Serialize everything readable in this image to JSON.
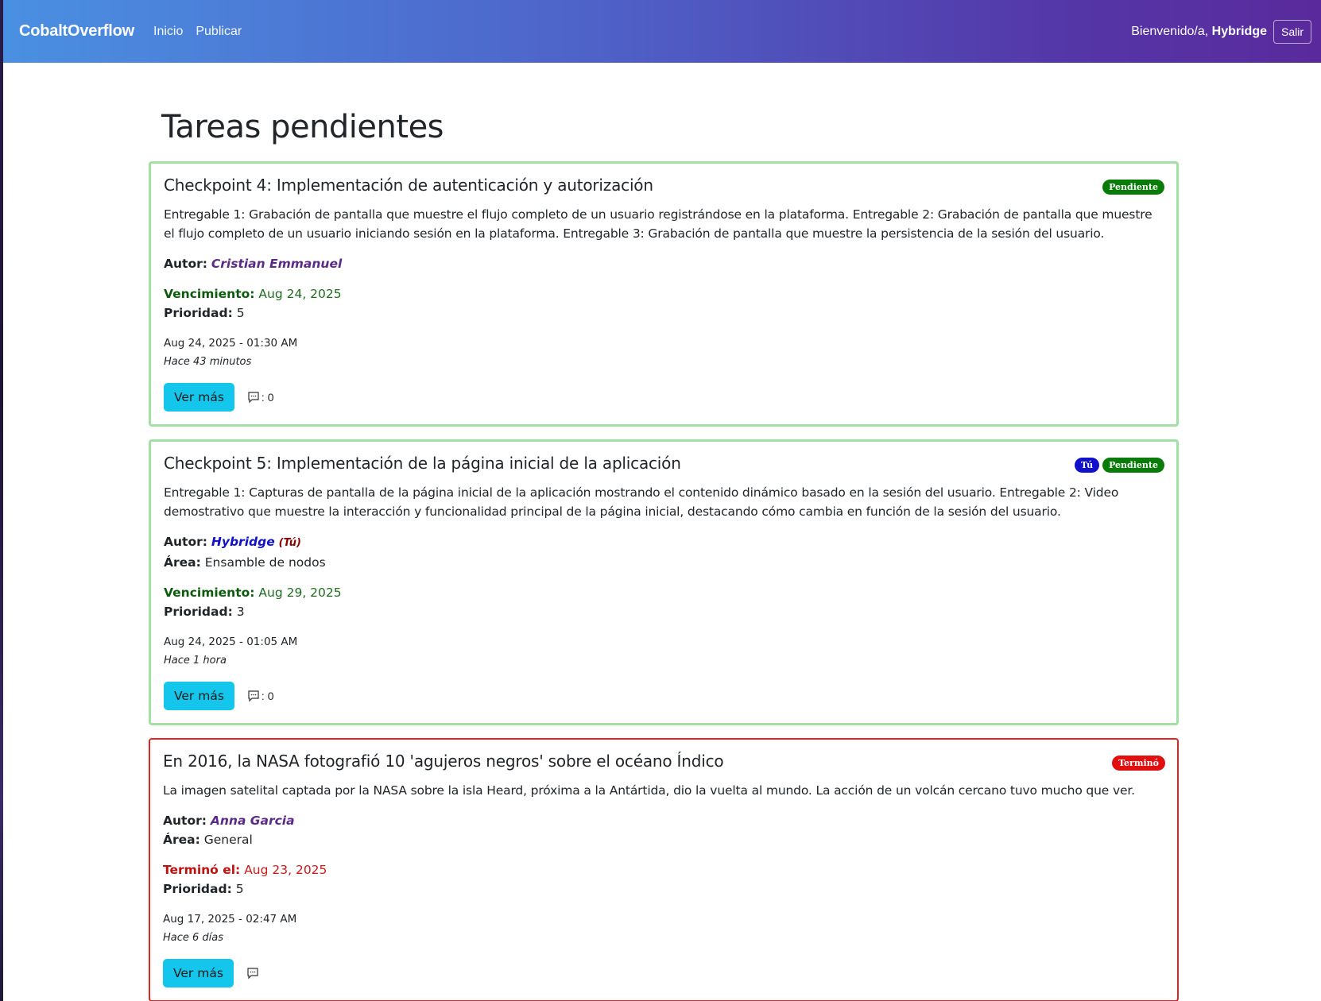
{
  "nav": {
    "brand": "CobaltOverflow",
    "links": [
      "Inicio",
      "Publicar"
    ],
    "welcome_prefix": "Bienvenido/a,",
    "username": "Hybridge",
    "logout": "Salir"
  },
  "page": {
    "title": "Tareas pendientes"
  },
  "labels": {
    "author": "Autor:",
    "area": "Área:",
    "due": "Vencimiento:",
    "ended": "Terminó el:",
    "priority": "Prioridad:",
    "more": "Ver más",
    "you": "(Tú)"
  },
  "tasks": [
    {
      "title": "Checkpoint 4: Implementación de autenticación y autorización",
      "badges": [
        "Pendiente"
      ],
      "description": "Entregable 1: Grabación de pantalla que muestre el flujo completo de un usuario registrándose en la plataforma. Entregable 2: Grabación de pantalla que muestre el flujo completo de un usuario iniciando sesión en la plataforma. Entregable 3: Grabación de pantalla que muestre la persistencia de la sesión del usuario.",
      "author": "Cristian Emmanuel",
      "due": "Aug 24, 2025",
      "priority": "5",
      "date": "Aug 24, 2025 - 01:30 AM",
      "ago": "Hace 43 minutos",
      "comments": ": 0"
    },
    {
      "title": "Checkpoint 5: Implementación de la página inicial de la aplicación",
      "badges": [
        "Tú",
        "Pendiente"
      ],
      "description": "Entregable 1: Capturas de pantalla de la página inicial de la aplicación mostrando el contenido dinámico basado en la sesión del usuario. Entregable 2: Video demostrativo que muestre la interacción y funcionalidad principal de la página inicial, destacando cómo cambia en función de la sesión del usuario.",
      "author": "Hybridge",
      "area": "Ensamble de nodos",
      "due": "Aug 29, 2025",
      "priority": "3",
      "date": "Aug 24, 2025 - 01:05 AM",
      "ago": "Hace 1 hora",
      "comments": ": 0"
    },
    {
      "title": "En 2016, la NASA fotografió 10 'agujeros negros' sobre el océano Índico",
      "badges": [
        "Terminó"
      ],
      "description": "La imagen satelital captada por la NASA sobre la isla Heard, próxima a la Antártida, dio la vuelta al mundo. La acción de un volcán cercano tuvo mucho que ver.",
      "author": "Anna Garcia",
      "area": "General",
      "ended": "Aug 23, 2025",
      "priority": "5",
      "date": "Aug 17, 2025 - 02:47 AM",
      "ago": "Hace 6 días"
    }
  ],
  "colors": {
    "nav_gradient_start": "#4a90e2",
    "nav_gradient_end": "#5a2a9c",
    "pending_border": "#a3e0a3",
    "expired_border": "#e02424",
    "button": "#14c6ec"
  }
}
